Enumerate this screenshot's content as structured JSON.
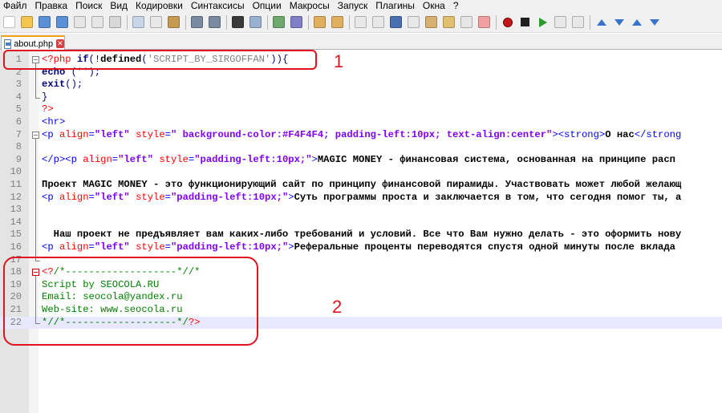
{
  "menu": [
    "Файл",
    "Правка",
    "Поиск",
    "Вид",
    "Кодировки",
    "Синтаксисы",
    "Опции",
    "Макросы",
    "Запуск",
    "Плагины",
    "Окна",
    "?"
  ],
  "tab": {
    "label": "about.php",
    "close": "✕"
  },
  "annotations": {
    "box1": "1",
    "box2": "2"
  },
  "colors": {
    "annotation": "#e0141e",
    "current_line": "#e8e8ff",
    "tab_accent": "#f0a020"
  },
  "lines": [
    {
      "n": "1",
      "segs": [
        [
          "php",
          "<?php "
        ],
        [
          "kw",
          "if"
        ],
        [
          "op",
          "(!"
        ],
        [
          "fn",
          "defined"
        ],
        [
          "op",
          "("
        ],
        [
          "str",
          "'SCRIPT_BY_SIRGOFFAN'"
        ],
        [
          "op",
          "))"
        ],
        [
          "op",
          "{"
        ]
      ]
    },
    {
      "n": "2",
      "segs": [
        [
          "kw",
          "echo "
        ],
        [
          "op",
          "("
        ],
        [
          "str",
          "''"
        ],
        [
          "op",
          ");"
        ]
      ]
    },
    {
      "n": "3",
      "segs": [
        [
          "kw",
          "exit"
        ],
        [
          "op",
          "();"
        ]
      ]
    },
    {
      "n": "4",
      "segs": [
        [
          "op",
          "}"
        ]
      ]
    },
    {
      "n": "5",
      "segs": [
        [
          "php",
          "?>"
        ]
      ]
    },
    {
      "n": "6",
      "segs": [
        [
          "tag",
          "<hr>"
        ]
      ]
    },
    {
      "n": "7",
      "segs": [
        [
          "tag",
          "<p "
        ],
        [
          "attr",
          "align"
        ],
        [
          "tag",
          "="
        ],
        [
          "aval",
          "\"left\""
        ],
        [
          "tag",
          " "
        ],
        [
          "attr",
          "style"
        ],
        [
          "tag",
          "="
        ],
        [
          "aval",
          "\" background-color:#F4F4F4; padding-left:10px; text-align:center\""
        ],
        [
          "tag",
          "><strong>"
        ],
        [
          "txt",
          "О нас"
        ],
        [
          "tag",
          "</strong"
        ]
      ]
    },
    {
      "n": "8",
      "segs": []
    },
    {
      "n": "9",
      "segs": [
        [
          "tag",
          "</p><p "
        ],
        [
          "attr",
          "align"
        ],
        [
          "tag",
          "="
        ],
        [
          "aval",
          "\"left\""
        ],
        [
          "tag",
          " "
        ],
        [
          "attr",
          "style"
        ],
        [
          "tag",
          "="
        ],
        [
          "aval",
          "\"padding-left:10px;\""
        ],
        [
          "tag",
          ">"
        ],
        [
          "txt",
          "MAGIC MONEY - финансовая система, основанная на принципе расп"
        ]
      ]
    },
    {
      "n": "10",
      "segs": []
    },
    {
      "n": "11",
      "segs": [
        [
          "txt",
          "Проект MAGIC MONEY - это функционирующий сайт по принципу финансовой пирамиды. Участвовать может любой желающ"
        ]
      ]
    },
    {
      "n": "12",
      "segs": [
        [
          "tag",
          "<p "
        ],
        [
          "attr",
          "align"
        ],
        [
          "tag",
          "="
        ],
        [
          "aval",
          "\"left\""
        ],
        [
          "tag",
          " "
        ],
        [
          "attr",
          "style"
        ],
        [
          "tag",
          "="
        ],
        [
          "aval",
          "\"padding-left:10px;\""
        ],
        [
          "tag",
          ">"
        ],
        [
          "txt",
          "Суть программы проста и заключается в том, что сегодня помог ты, а"
        ]
      ]
    },
    {
      "n": "13",
      "segs": []
    },
    {
      "n": "14",
      "segs": []
    },
    {
      "n": "15",
      "segs": [
        [
          "txt",
          "  Наш проект не предъявляет вам каких-либо требований и условий. Все что Вам нужно делать - это оформить нову"
        ]
      ]
    },
    {
      "n": "16",
      "segs": [
        [
          "tag",
          "<p "
        ],
        [
          "attr",
          "align"
        ],
        [
          "tag",
          "="
        ],
        [
          "aval",
          "\"left\""
        ],
        [
          "tag",
          " "
        ],
        [
          "attr",
          "style"
        ],
        [
          "tag",
          "="
        ],
        [
          "aval",
          "\"padding-left:10px;\""
        ],
        [
          "tag",
          ">"
        ],
        [
          "txt",
          "Реферальные проценты переводятся спустя одной минуты после вклада"
        ]
      ]
    },
    {
      "n": "17",
      "segs": []
    },
    {
      "n": "18",
      "segs": [
        [
          "php",
          "<?"
        ],
        [
          "cmt",
          "/*-------------------*//*"
        ]
      ]
    },
    {
      "n": "19",
      "segs": [
        [
          "cmt",
          "Script by SEOCOLA.RU"
        ]
      ]
    },
    {
      "n": "20",
      "segs": [
        [
          "cmt",
          "Email: seocola@yandex.ru"
        ]
      ]
    },
    {
      "n": "21",
      "segs": [
        [
          "cmt",
          "Web-site: www.seocola.ru"
        ]
      ]
    },
    {
      "n": "22",
      "segs": [
        [
          "cmt",
          "*//*-------------------*/"
        ],
        [
          "php",
          "?>"
        ]
      ]
    }
  ]
}
